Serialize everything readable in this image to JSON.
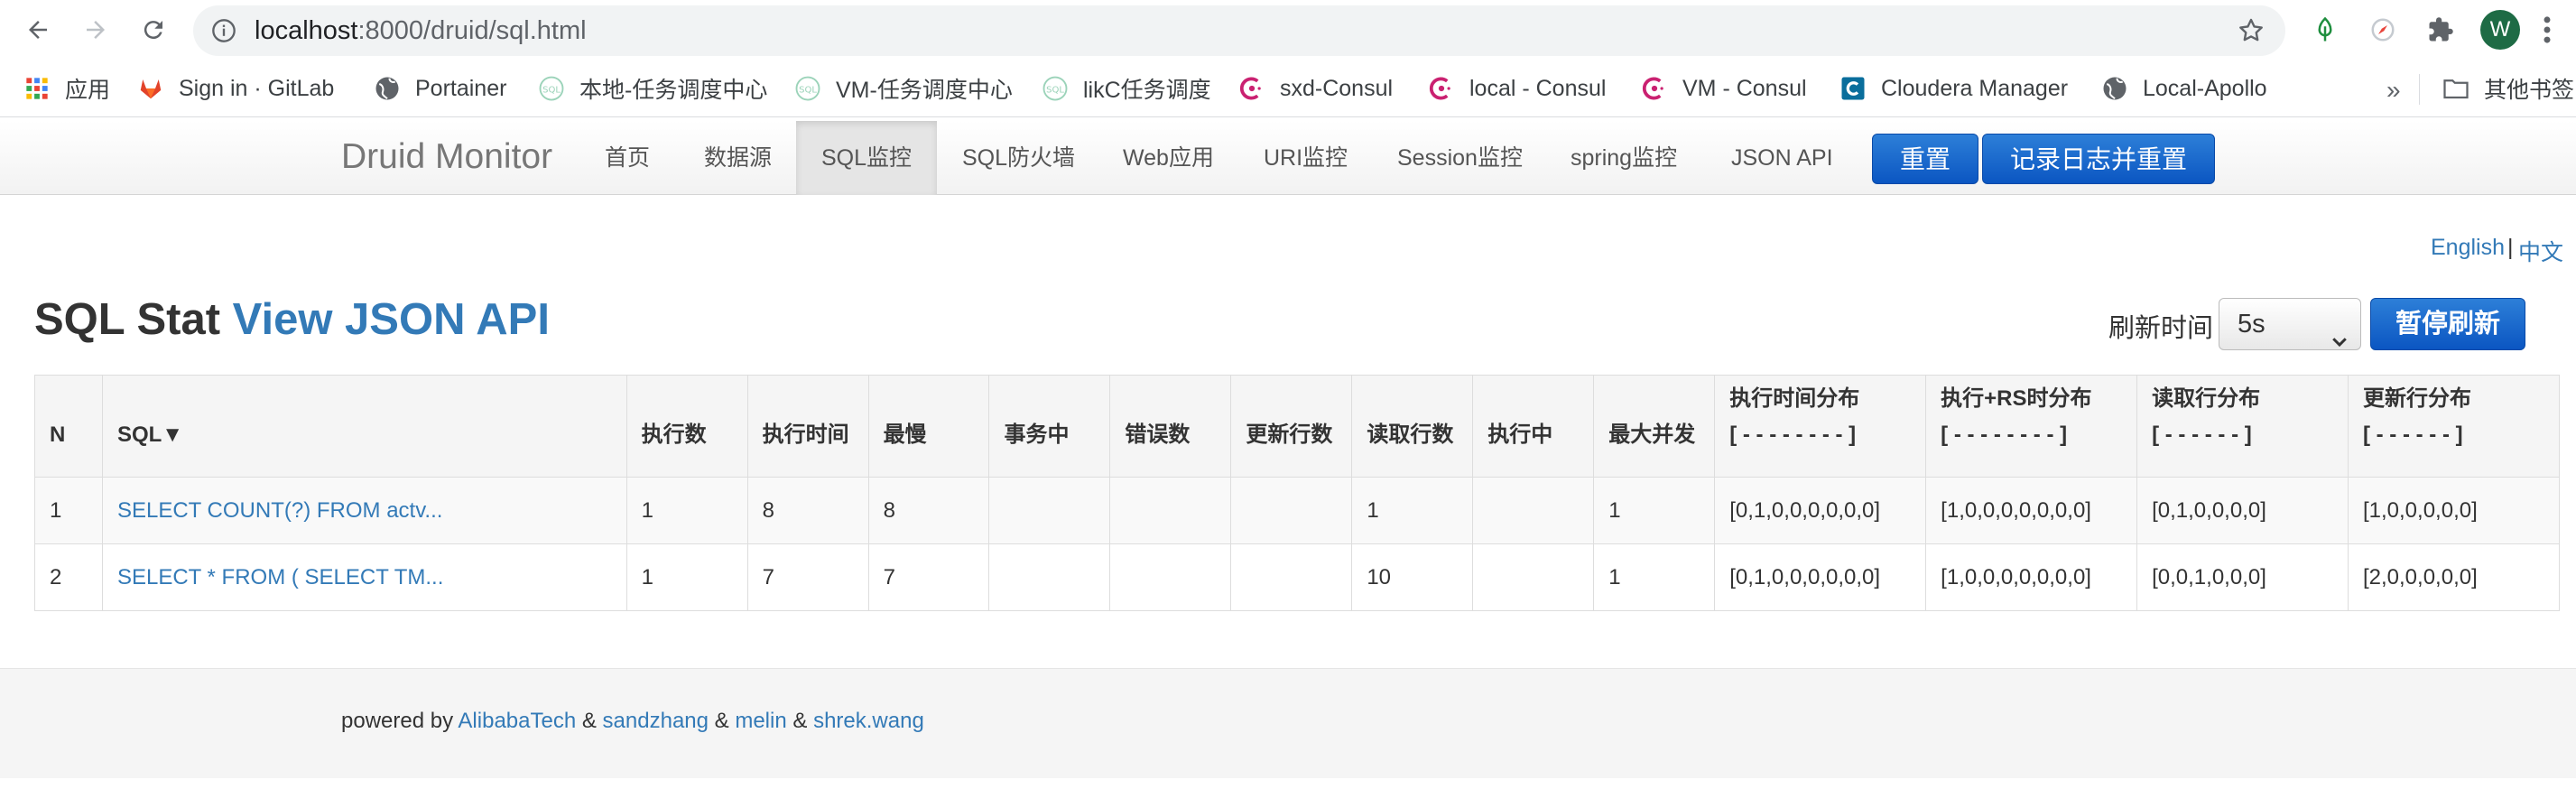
{
  "browser": {
    "url_host": "localhost",
    "url_rest": ":8000/druid/sql.html",
    "avatar_letter": "W",
    "bookmarks": [
      {
        "label": "应用",
        "icon": "apps-grid-icon"
      },
      {
        "label": "Sign in · GitLab",
        "icon": "gitlab-icon"
      },
      {
        "label": "Portainer",
        "icon": "globe-icon"
      },
      {
        "label": "本地-任务调度中心",
        "icon": "xxl-job-icon"
      },
      {
        "label": "VM-任务调度中心",
        "icon": "xxl-job-icon"
      },
      {
        "label": "likC任务调度",
        "icon": "xxl-job-icon"
      },
      {
        "label": "sxd-Consul",
        "icon": "consul-icon"
      },
      {
        "label": "local - Consul",
        "icon": "consul-icon"
      },
      {
        "label": "VM - Consul",
        "icon": "consul-icon"
      },
      {
        "label": "Cloudera Manager",
        "icon": "cloudera-icon"
      },
      {
        "label": "Local-Apollo",
        "icon": "globe-icon"
      }
    ],
    "bookmarks_more": "»",
    "other_bookmarks": "其他书签"
  },
  "navbar": {
    "brand": "Druid Monitor",
    "items": [
      "首页",
      "数据源",
      "SQL监控",
      "SQL防火墙",
      "Web应用",
      "URI监控",
      "Session监控",
      "spring监控",
      "JSON API"
    ],
    "active_index": 2,
    "reset_button": "重置",
    "log_reset_button": "记录日志并重置"
  },
  "lang": {
    "english": "English",
    "separator": "|",
    "chinese": "中文"
  },
  "main": {
    "title": "SQL Stat",
    "title_link": "View JSON API",
    "refresh_label": "刷新时间",
    "refresh_value": "5s",
    "pause_button": "暂停刷新"
  },
  "table": {
    "headers": [
      "N",
      "SQL▼",
      "执行数",
      "执行时间",
      "最慢",
      "事务中",
      "错误数",
      "更新行数",
      "读取行数",
      "执行中",
      "最大并发",
      "执行时间分布",
      "执行+RS时分布",
      "读取行分布",
      "更新行分布"
    ],
    "header_subs": {
      "11": "[ - - - - - - - - ]",
      "12": "[ - - - - - - - - ]",
      "13": "[ - - - - - - ]",
      "14": "[ - - - - - - ]"
    },
    "rows": [
      [
        "1",
        "SELECT COUNT(?) FROM actv...",
        "1",
        "8",
        "8",
        "",
        "",
        "",
        "1",
        "",
        "1",
        "[0,1,0,0,0,0,0,0]",
        "[1,0,0,0,0,0,0,0]",
        "[0,1,0,0,0,0]",
        "[1,0,0,0,0,0]"
      ],
      [
        "2",
        "SELECT * FROM ( SELECT TM...",
        "1",
        "7",
        "7",
        "",
        "",
        "",
        "10",
        "",
        "1",
        "[0,1,0,0,0,0,0,0]",
        "[1,0,0,0,0,0,0,0]",
        "[0,0,1,0,0,0]",
        "[2,0,0,0,0,0]"
      ]
    ]
  },
  "footer": {
    "prefix": "powered by",
    "amp": "&",
    "links": [
      "AlibabaTech",
      "sandzhang",
      "melin",
      "shrek.wang"
    ]
  }
}
